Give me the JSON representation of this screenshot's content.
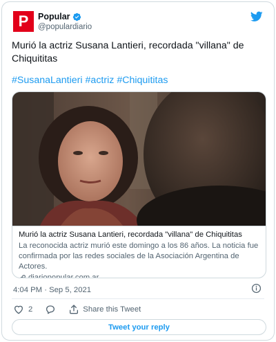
{
  "author": {
    "display_name": "Popular",
    "handle": "@populardiario",
    "avatar_letter": "P",
    "avatar_color": "#e2001a",
    "verified": true
  },
  "tweet": {
    "text": "Murió la actriz Susana Lantieri, recordada \"villana\" de Chiquititas",
    "hashtags": [
      "#SusanaLantieri",
      "#actriz",
      "#Chiquititas"
    ],
    "timestamp": "4:04 PM · Sep 5, 2021"
  },
  "card": {
    "title": "Murió la actriz Susana Lantieri, recordada \"villana\" de Chiquititas",
    "description": "La reconocida actriz murió este domingo a los 86 años. La noticia fue confirmada por las redes sociales de la Asociación Argentina de Actores.",
    "domain": "diariopopular.com.ar"
  },
  "actions": {
    "like_count": "2",
    "share_label": "Share this Tweet",
    "reply_button_label": "Tweet your reply"
  },
  "icons": {
    "bird": "twitter-bird-icon",
    "verified": "verified-badge-icon",
    "info": "info-icon",
    "like": "heart-icon",
    "reply": "reply-icon",
    "share": "share-icon",
    "link": "link-icon"
  },
  "colors": {
    "accent": "#1d9bf0",
    "text": "#0f1419",
    "muted": "#536471",
    "border": "#cfd9de"
  }
}
